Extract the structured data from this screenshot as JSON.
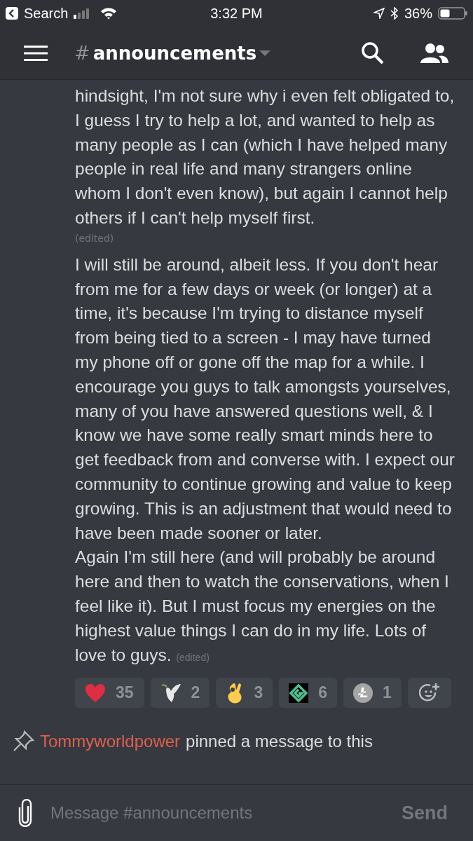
{
  "status_bar": {
    "back_label": "Search",
    "time": "3:32 PM",
    "battery": "36%"
  },
  "header": {
    "hash": "#",
    "channel": "announcements"
  },
  "messages": [
    {
      "paragraphs": [
        "hindsight, I'm not sure why i even felt obligated to, I guess I try to help a lot, and wanted to help as many people as I can (which I have helped many people in real life and many strangers online whom I don't even know), but again I cannot help others if I can't help myself first."
      ],
      "edited": "(edited)",
      "edited_inline": false
    },
    {
      "paragraphs": [
        "I will still be around, albeit less. If you don't hear from me for a few days or week (or longer) at a time, it's because I'm trying to distance myself from being tied to a screen - I may have turned my phone off or gone off the map for a while. I encourage you guys to talk amongsts yourselves, many of you have answered questions well, & I know we have some really smart minds here to get feedback from and converse with. I expect our community to continue growing and value to keep growing. This is an adjustment that would need to have been made sooner or later.",
        "Again I'm still here (and will probably be around here and then to watch the conservations, when I feel like it). But I must focus my energies on the highest value things I can do in my life. Lots of love to guys."
      ],
      "edited": "(edited)",
      "edited_inline": true
    }
  ],
  "reactions": [
    {
      "kind": "heart",
      "count": "35"
    },
    {
      "kind": "dove",
      "count": "2"
    },
    {
      "kind": "ok",
      "count": "3"
    },
    {
      "kind": "e",
      "count": "6"
    },
    {
      "kind": "coin",
      "count": "1"
    }
  ],
  "pinned": {
    "user": "Tommyworldpower",
    "text": "pinned a message to this"
  },
  "composer": {
    "placeholder": "Message #announcements",
    "send": "Send"
  }
}
